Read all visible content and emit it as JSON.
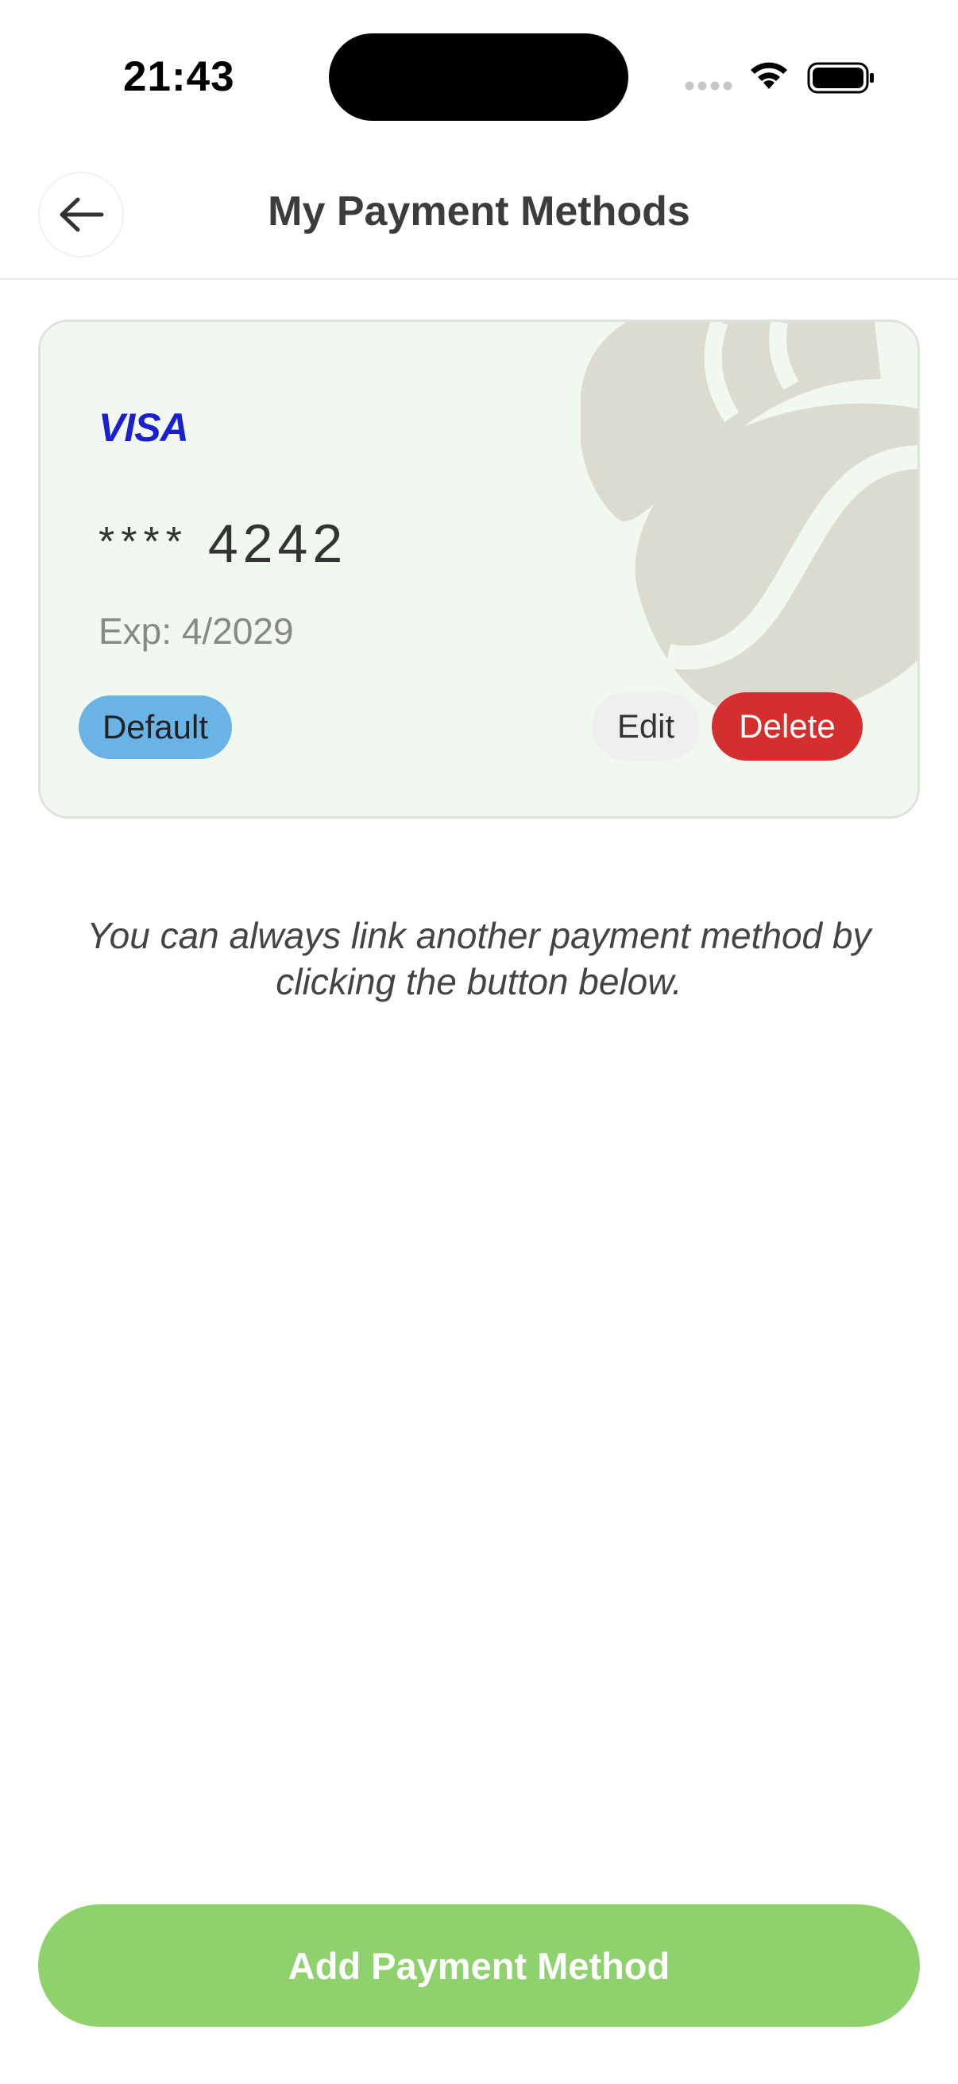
{
  "status_bar": {
    "time": "21:43"
  },
  "header": {
    "title": "My Payment Methods",
    "back_icon": "arrow-left-icon"
  },
  "card": {
    "brand": "VISA",
    "mask": "****",
    "last4": "4242",
    "expiry": "Exp: 4/2029",
    "default_label": "Default",
    "edit_label": "Edit",
    "delete_label": "Delete",
    "colors": {
      "background": "#f1f8ef",
      "brand": "#1a1fcf",
      "default_badge": "#69b3e7",
      "delete": "#d42e2e"
    }
  },
  "info": {
    "text": "You can always link another payment method by clicking the button below."
  },
  "footer": {
    "add_label": "Add Payment Method",
    "accent": "#8fd16d"
  }
}
